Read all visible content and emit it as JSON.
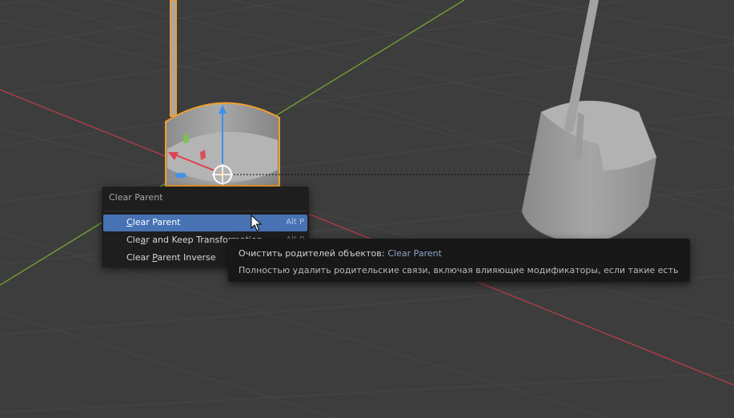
{
  "menu": {
    "title": "Clear Parent",
    "items": [
      {
        "pre": "",
        "mnemonic": "C",
        "post": "lear Parent",
        "shortcut": "Alt P",
        "active": true
      },
      {
        "pre": "Cle",
        "mnemonic": "a",
        "post": "r and Keep Transformation",
        "shortcut": "Alt P",
        "active": false
      },
      {
        "pre": "Clear ",
        "mnemonic": "P",
        "post": "arent Inverse",
        "shortcut": "",
        "active": false
      }
    ]
  },
  "tooltip": {
    "title": "Очистить родителей объектов:",
    "python_label": "Clear Parent",
    "description": "Полностью удалить родительские связи, включая влияющие модификаторы, если такие есть"
  },
  "viewport": {
    "background_color": "#3d3d3d",
    "x_axis_color": "#b53c48",
    "y_axis_color": "#76a632",
    "selection_outline_color": "#f0a030",
    "gizmo_z_color": "#3c90ee",
    "gizmo_x_color": "#e0404f",
    "gizmo_y_color": "#7bc44a"
  }
}
